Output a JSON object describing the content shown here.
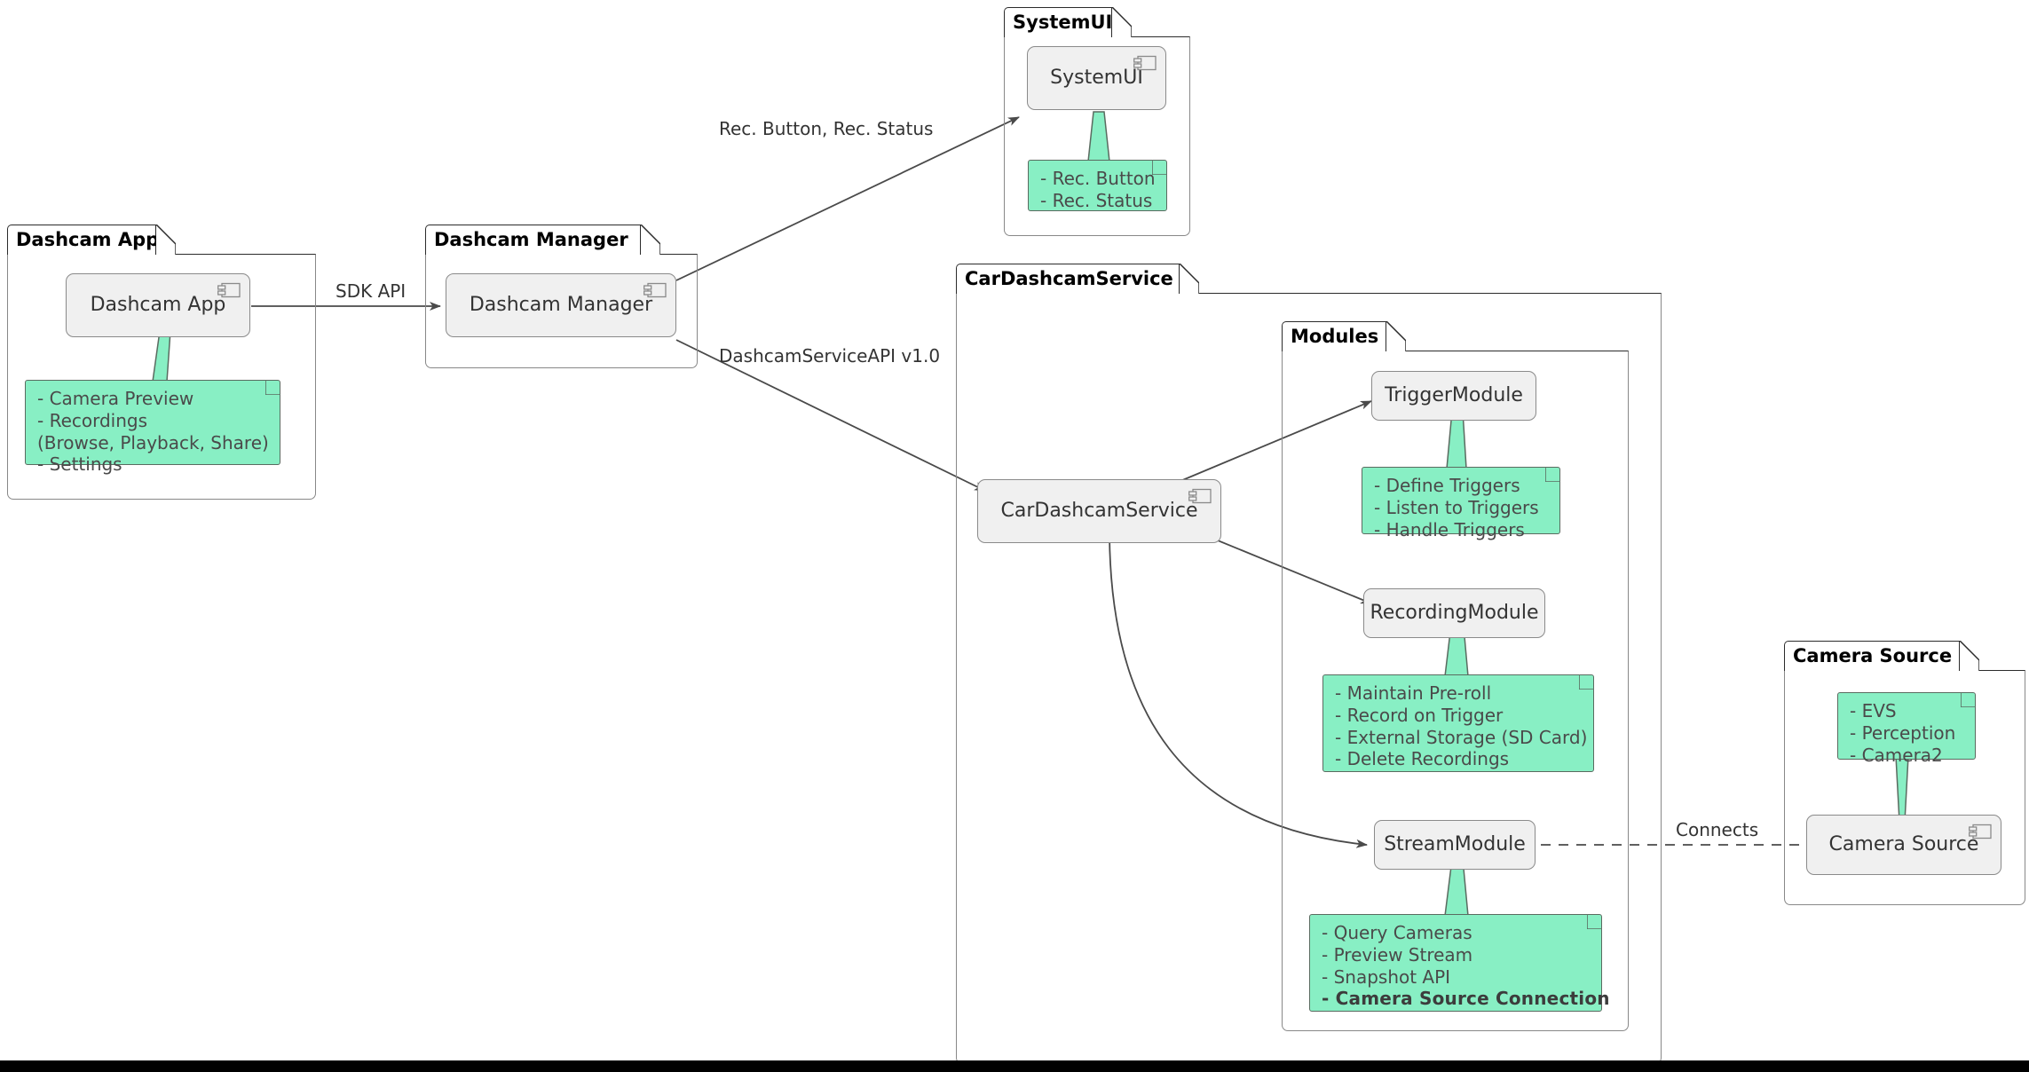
{
  "diagram": {
    "type": "uml-component-diagram",
    "title": "Dashcam Architecture",
    "colors": {
      "note_fill": "#88EFC4",
      "note_border": "#5a6b60",
      "component_fill": "#F0F0F0",
      "component_border": "#8a8a8a",
      "package_border": "#888888",
      "package_tab_border": "#2b2b2b",
      "text": "#333333",
      "edge": "#555555",
      "background": "#ffffff"
    }
  },
  "packages": {
    "dashcam_app": {
      "title": "Dashcam App"
    },
    "dashcam_manager": {
      "title": "Dashcam Manager"
    },
    "system_ui": {
      "title": "SystemUI"
    },
    "car_dashcam_service": {
      "title": "CarDashcamService"
    },
    "modules": {
      "title": "Modules"
    },
    "camera_source": {
      "title": "Camera Source"
    }
  },
  "components": {
    "dashcam_app": {
      "label": "Dashcam App"
    },
    "dashcam_manager": {
      "label": "Dashcam Manager"
    },
    "system_ui": {
      "label": "SystemUI"
    },
    "car_dashcam_service": {
      "label": "CarDashcamService"
    },
    "trigger_module": {
      "label": "TriggerModule"
    },
    "recording_module": {
      "label": "RecordingModule"
    },
    "stream_module": {
      "label": "StreamModule"
    },
    "camera_source": {
      "label": "Camera Source"
    }
  },
  "notes": {
    "dashcam_app": {
      "lines": [
        {
          "text": "- Camera Preview",
          "bold": false
        },
        {
          "text": "- Recordings",
          "bold": false
        },
        {
          "text": "  (Browse, Playback, Share)",
          "bold": false
        },
        {
          "text": "- Settings",
          "bold": false
        }
      ]
    },
    "system_ui": {
      "lines": [
        {
          "text": "- Rec. Button",
          "bold": false
        },
        {
          "text": "- Rec. Status",
          "bold": false
        }
      ]
    },
    "trigger_module": {
      "lines": [
        {
          "text": "- Define Triggers",
          "bold": false
        },
        {
          "text": "- Listen to Triggers",
          "bold": false
        },
        {
          "text": "- Handle Triggers",
          "bold": false
        }
      ]
    },
    "recording_module": {
      "lines": [
        {
          "text": "- Maintain Pre-roll",
          "bold": false
        },
        {
          "text": "- Record on Trigger",
          "bold": false
        },
        {
          "text": "- External Storage (SD Card)",
          "bold": false
        },
        {
          "text": "- Delete Recordings",
          "bold": false
        }
      ]
    },
    "stream_module": {
      "lines": [
        {
          "text": "- Query Cameras",
          "bold": false
        },
        {
          "text": "- Preview Stream",
          "bold": false
        },
        {
          "text": "- Snapshot API",
          "bold": false
        },
        {
          "text": "- Camera Source Connection",
          "bold": true
        }
      ]
    },
    "camera_source": {
      "lines": [
        {
          "text": "- EVS",
          "bold": false
        },
        {
          "text": "- Perception",
          "bold": false
        },
        {
          "text": "- Camera2",
          "bold": false
        }
      ]
    }
  },
  "edges": {
    "sdk_api": {
      "label": "SDK API",
      "from": "Dashcam App",
      "to": "Dashcam Manager",
      "style": "solid-arrow"
    },
    "rec_button_status": {
      "label": "Rec. Button, Rec. Status",
      "from": "Dashcam Manager",
      "to": "SystemUI",
      "style": "solid-arrow"
    },
    "dashcam_service_api": {
      "label": "DashcamServiceAPI v1.0",
      "from": "Dashcam Manager",
      "to": "CarDashcamService",
      "style": "solid-arrow"
    },
    "service_to_trigger": {
      "label": "",
      "from": "CarDashcamService",
      "to": "TriggerModule",
      "style": "solid-arrow"
    },
    "service_to_recording": {
      "label": "",
      "from": "CarDashcamService",
      "to": "RecordingModule",
      "style": "solid-arrow"
    },
    "service_to_stream": {
      "label": "",
      "from": "CarDashcamService",
      "to": "StreamModule",
      "style": "solid-arrow-curved"
    },
    "connects": {
      "label": "Connects",
      "from": "StreamModule",
      "to": "Camera Source",
      "style": "dashed"
    }
  }
}
